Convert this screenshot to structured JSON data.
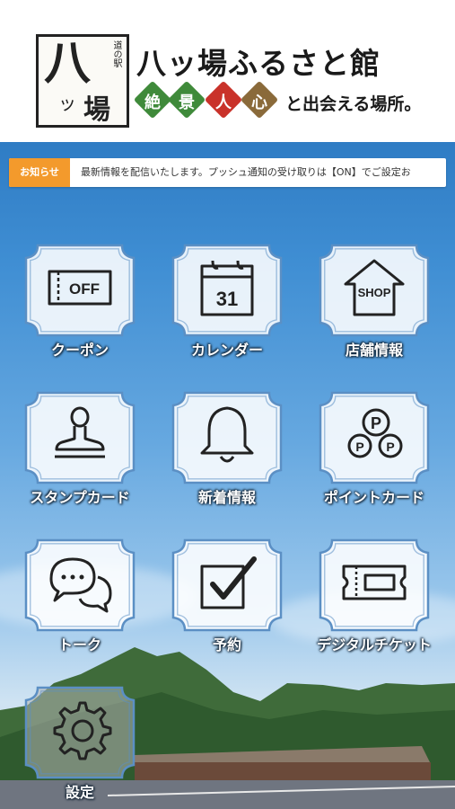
{
  "header": {
    "logo": {
      "sub": "道の駅",
      "big": "八",
      "small": "場",
      "tiny": "ッ"
    },
    "title": "八ッ場ふるさと館",
    "diamonds": [
      {
        "char": "絶",
        "color": "#3f8a3a"
      },
      {
        "char": "景",
        "color": "#3f8a3a"
      },
      {
        "char": "人",
        "color": "#c9322a"
      },
      {
        "char": "心",
        "color": "#8a6a3a"
      }
    ],
    "tagline": "と出会える場所。"
  },
  "news": {
    "tag": "お知らせ",
    "text": "最新情報を配信いたします。プッシュ通知の受け取りは【ON】でご設定お"
  },
  "menu": [
    {
      "label": "クーポン",
      "icon": "coupon-icon",
      "icon_text": "OFF"
    },
    {
      "label": "カレンダー",
      "icon": "calendar-icon",
      "icon_text": "31"
    },
    {
      "label": "店舗情報",
      "icon": "shop-icon",
      "icon_text": "SHOP"
    },
    {
      "label": "スタンプカード",
      "icon": "stamp-icon"
    },
    {
      "label": "新着情報",
      "icon": "bell-icon"
    },
    {
      "label": "ポイントカード",
      "icon": "point-icon",
      "icon_text": "P"
    },
    {
      "label": "トーク",
      "icon": "chat-icon"
    },
    {
      "label": "予約",
      "icon": "checkbox-icon"
    },
    {
      "label": "デジタルチケット",
      "icon": "ticket-icon"
    },
    {
      "label": "設定",
      "icon": "gear-icon"
    }
  ],
  "colors": {
    "news_tag": "#f39a2c",
    "tile_border": "#5b8fc4"
  }
}
